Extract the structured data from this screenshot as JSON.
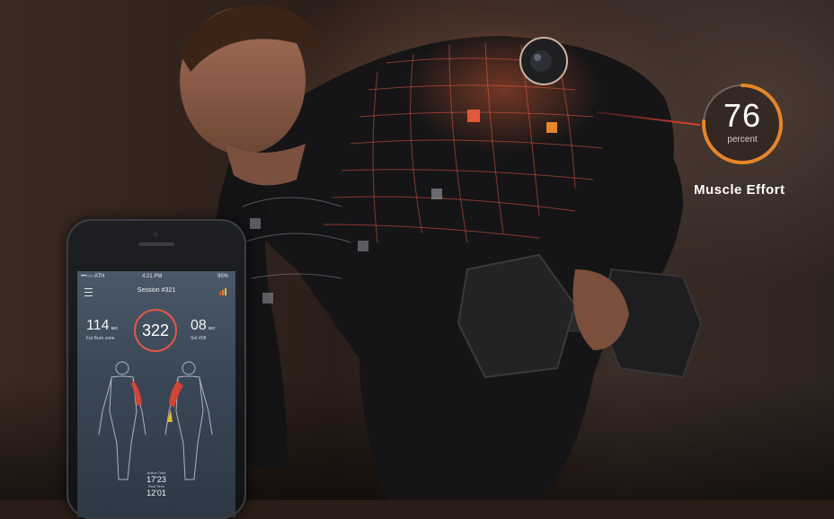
{
  "muscle_effort": {
    "value": "76",
    "unit": "percent",
    "caption": "Muscle Effort",
    "level_percent": 76
  },
  "phone_app": {
    "status_bar": {
      "carrier": "•••○○ ATH",
      "time": "4:21 PM",
      "battery": "95%"
    },
    "session_title": "Session #321",
    "counter": "322",
    "left_stat": {
      "value": "114",
      "unit": "sec",
      "label": "Fat Burn zone"
    },
    "right_stat": {
      "value": "08",
      "unit": "sec",
      "label": "Set #08"
    },
    "time_block": [
      {
        "label": "Active Time",
        "value": "17'23"
      },
      {
        "label": "Rest Time",
        "value": "12'01"
      }
    ]
  },
  "colors": {
    "accent_red": "#e04030",
    "accent_orange": "#e5862a",
    "accent_yellow": "#f1c232"
  }
}
